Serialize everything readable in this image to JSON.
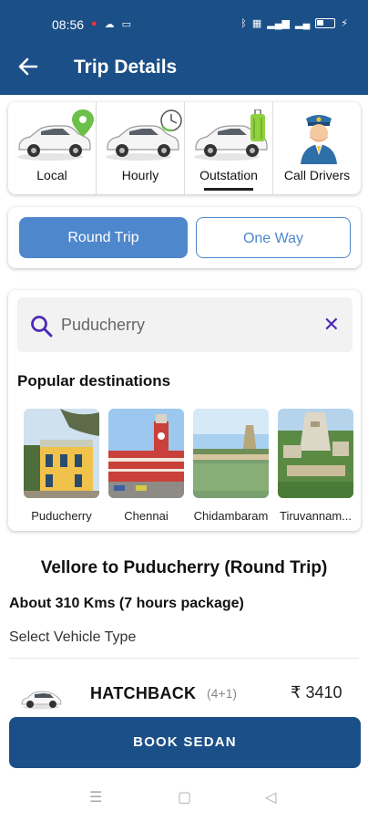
{
  "status_bar": {
    "time": "08:56"
  },
  "header": {
    "title": "Trip Details"
  },
  "categories": [
    {
      "label": "Local",
      "icon": "car-location-icon"
    },
    {
      "label": "Hourly",
      "icon": "car-clock-icon"
    },
    {
      "label": "Outstation",
      "icon": "car-luggage-icon",
      "selected": true
    },
    {
      "label": "Call Drivers",
      "icon": "driver-icon"
    }
  ],
  "trip_type": {
    "round_trip": "Round Trip",
    "one_way": "One Way",
    "selected": "Round Trip"
  },
  "search": {
    "value": "Puducherry"
  },
  "popular": {
    "heading": "Popular destinations",
    "items": [
      {
        "caption": "Puducherry"
      },
      {
        "caption": "Chennai"
      },
      {
        "caption": "Chidambaram"
      },
      {
        "caption": "Tiruvannam..."
      }
    ]
  },
  "trip": {
    "route": "Vellore to Puducherry (Round Trip)",
    "about": "About 310 Kms (7 hours package)",
    "select_label": "Select Vehicle Type"
  },
  "vehicle": {
    "name": "HATCHBACK",
    "seats": "(4+1)",
    "price": "₹ 3410"
  },
  "book_button": "BOOK SEDAN",
  "colors": {
    "primary": "#1b4f87",
    "accent": "#4f87cc"
  }
}
